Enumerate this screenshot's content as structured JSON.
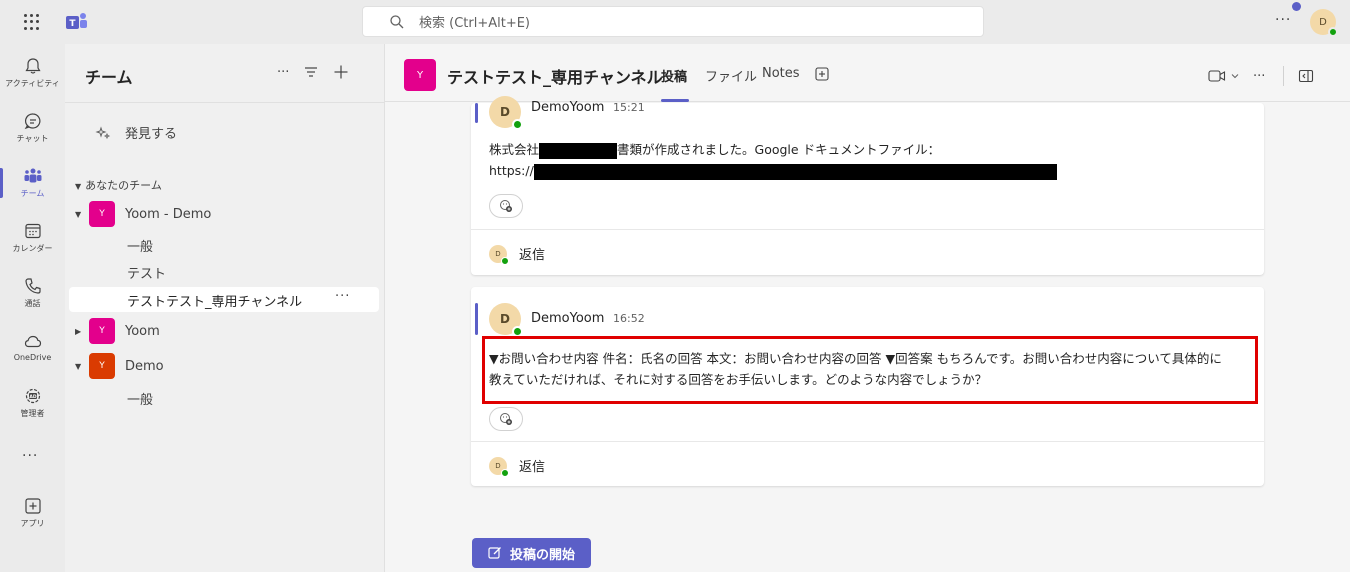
{
  "topbar": {
    "search_placeholder": "検索 (Ctrl+Alt+E)",
    "more_label": "···",
    "avatar_initial": "D"
  },
  "rail": {
    "items": [
      {
        "label": "アクティビティ",
        "icon": "bell-icon"
      },
      {
        "label": "チャット",
        "icon": "chat-icon"
      },
      {
        "label": "チーム",
        "icon": "teams-icon"
      },
      {
        "label": "カレンダー",
        "icon": "calendar-icon"
      },
      {
        "label": "通話",
        "icon": "phone-icon"
      },
      {
        "label": "OneDrive",
        "icon": "cloud-icon"
      },
      {
        "label": "管理者",
        "icon": "admin-icon"
      },
      {
        "label": "アプリ",
        "icon": "add-app-icon"
      }
    ],
    "more_label": "···"
  },
  "panel": {
    "title": "チーム",
    "more_label": "···",
    "discover_label": "発見する",
    "section_label": "あなたのチーム",
    "teams": [
      {
        "name": "Yoom - Demo",
        "avatar": "Y",
        "color": "#e3008c",
        "expanded": true,
        "channels": [
          "一般",
          "テスト",
          "テストテスト_専用チャンネル"
        ]
      },
      {
        "name": "Yoom",
        "avatar": "Y",
        "color": "#e3008c",
        "expanded": false,
        "channels": []
      },
      {
        "name": "Demo",
        "avatar": "Y",
        "color": "#da3b01",
        "expanded": true,
        "channels": [
          "一般"
        ]
      }
    ],
    "active_channel_more": "···"
  },
  "channel": {
    "avatar": "Y",
    "title": "テストテスト_専用チャンネル",
    "tabs": [
      "投稿",
      "ファイル",
      "Notes"
    ],
    "active_tab": "投稿",
    "more_label": "···"
  },
  "posts": [
    {
      "author": "DemoYoom",
      "time": "15:21",
      "avatar_initial": "D",
      "line1_prefix": "株式会社",
      "line1_suffix": "書類が作成されました。Google ドキュメントファイル：",
      "line2_prefix": "https://",
      "reply_label": "返信",
      "reply_avatar": "D"
    },
    {
      "author": "DemoYoom",
      "time": "16:52",
      "avatar_initial": "D",
      "line1": "▼お問い合わせ内容 件名：氏名の回答 本文：お問い合わせ内容の回答 ▼回答案 もちろんです。お問い合わせ内容について具体的に",
      "line2": "教えていただければ、それに対する回答をお手伝いします。どのような内容でしょうか？",
      "reply_label": "返信",
      "reply_avatar": "D"
    }
  ],
  "new_post_label": "投稿の開始",
  "colors": {
    "accent": "#5b5fc7",
    "team_magenta": "#e3008c",
    "team_orange": "#da3b01",
    "highlight_red": "#e00000",
    "presence_green": "#13a10e"
  }
}
